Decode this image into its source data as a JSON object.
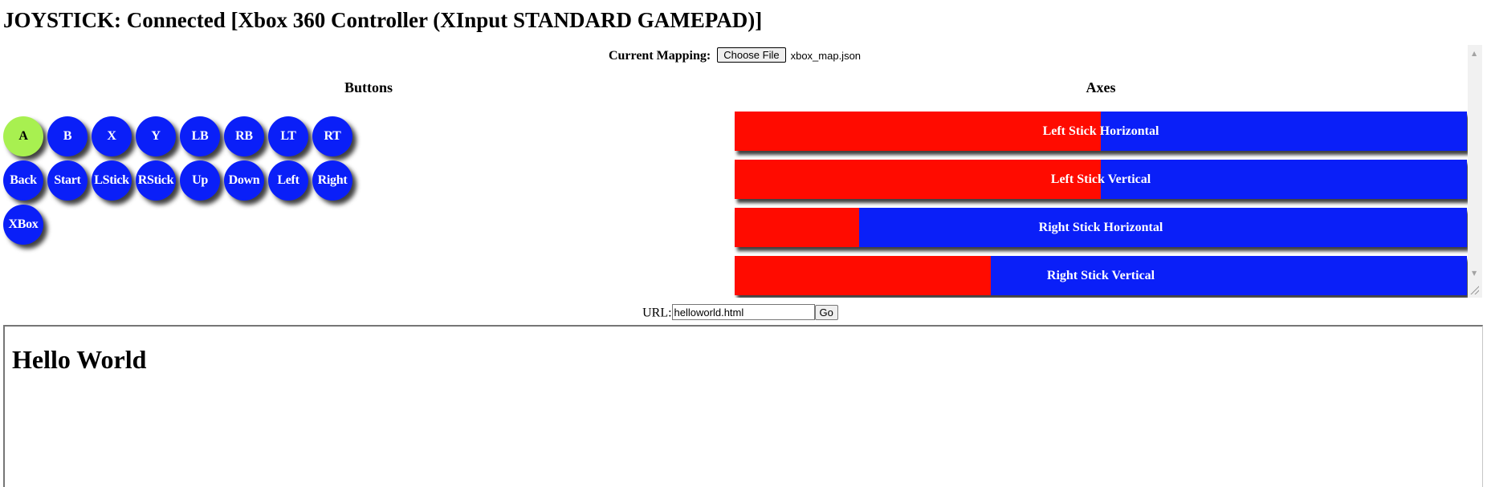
{
  "status": {
    "text": "JOYSTICK: Connected [Xbox 360 Controller (XInput STANDARD GAMEPAD)]"
  },
  "mapping": {
    "label": "Current Mapping:",
    "choose_button": "Choose File",
    "file_name": "xbox_map.json"
  },
  "buttons_section": {
    "heading": "Buttons",
    "items": [
      {
        "label": "A",
        "pressed": true
      },
      {
        "label": "B",
        "pressed": false
      },
      {
        "label": "X",
        "pressed": false
      },
      {
        "label": "Y",
        "pressed": false
      },
      {
        "label": "LB",
        "pressed": false
      },
      {
        "label": "RB",
        "pressed": false
      },
      {
        "label": "LT",
        "pressed": false
      },
      {
        "label": "RT",
        "pressed": false
      },
      {
        "label": "Back",
        "pressed": false
      },
      {
        "label": "Start",
        "pressed": false
      },
      {
        "label": "LStick",
        "pressed": false
      },
      {
        "label": "RStick",
        "pressed": false
      },
      {
        "label": "Up",
        "pressed": false
      },
      {
        "label": "Down",
        "pressed": false
      },
      {
        "label": "Left",
        "pressed": false
      },
      {
        "label": "Right",
        "pressed": false
      },
      {
        "label": "XBox",
        "pressed": false
      }
    ]
  },
  "axes_section": {
    "heading": "Axes",
    "items": [
      {
        "label": "Left Stick Horizontal",
        "fill_fraction": 0.5
      },
      {
        "label": "Left Stick Vertical",
        "fill_fraction": 0.5
      },
      {
        "label": "Right Stick Horizontal",
        "fill_fraction": 0.17
      },
      {
        "label": "Right Stick Vertical",
        "fill_fraction": 0.35
      }
    ]
  },
  "url_bar": {
    "label": "URL:",
    "value": "helloworld.html",
    "go_button": "Go"
  },
  "frame": {
    "heading": "Hello World"
  },
  "colors": {
    "button_default": "#0a1ff8",
    "button_pressed": "#a8f050",
    "axis_negative": "#ff0b00",
    "axis_positive": "#0a1ff8"
  }
}
